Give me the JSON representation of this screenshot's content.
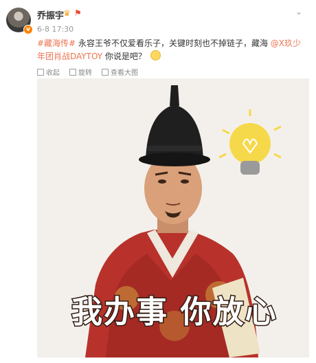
{
  "post": {
    "author": "乔振宇",
    "time": "6-8 17:30",
    "hashtag": "#藏海传#",
    "text_main": " 永容王爷不仅爱看乐子，关键时刻也不掉链子，藏海",
    "mention": "@X玖少年团肖战DAYTOY",
    "text_end": " 你说是吧？"
  },
  "tools": {
    "collect": "收起",
    "rotate": "旋转",
    "view_large": "查看大图"
  },
  "image": {
    "caption": "我办事 你放心"
  }
}
